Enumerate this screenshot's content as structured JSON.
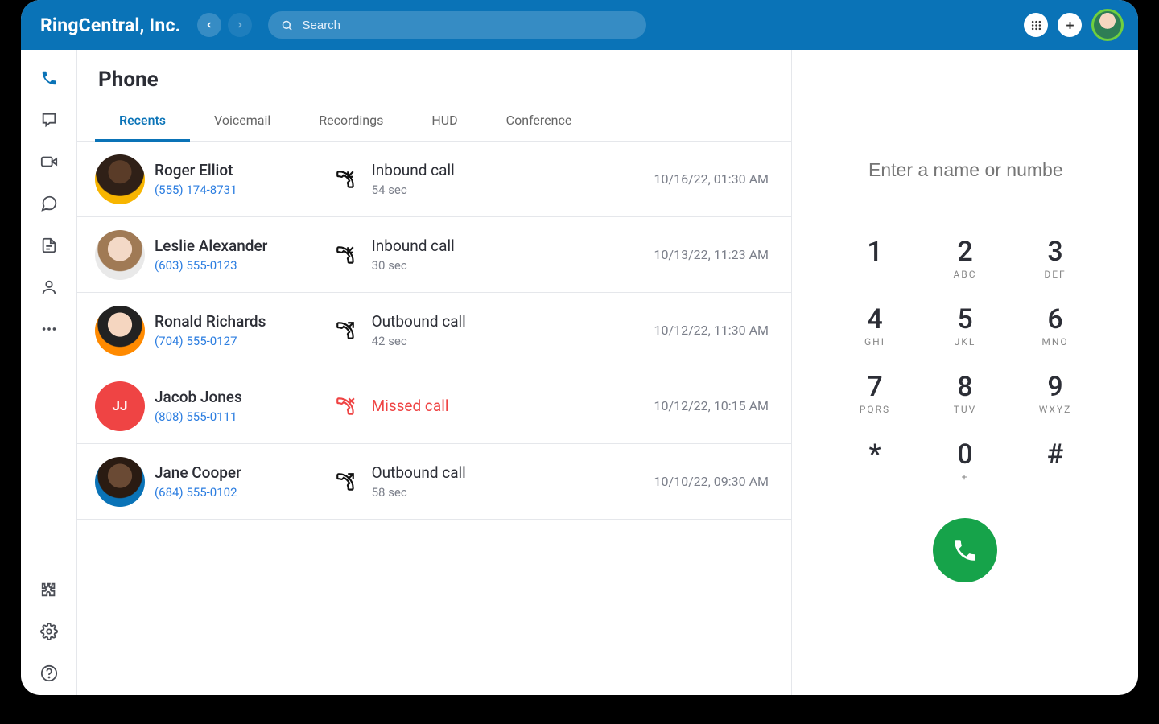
{
  "header": {
    "brand": "RingCentral, Inc.",
    "search_placeholder": "Search"
  },
  "page": {
    "title": "Phone"
  },
  "tabs": [
    "Recents",
    "Voicemail",
    "Recordings",
    "HUD",
    "Conference"
  ],
  "active_tab": 0,
  "calls": [
    {
      "name": "Roger Elliot",
      "number": "(555) 174-8731",
      "type": "Inbound call",
      "duration": "54 sec",
      "time": "10/16/22, 01:30 AM",
      "missed": false,
      "dir": "in",
      "initials": "",
      "avClass": "av-1"
    },
    {
      "name": "Leslie Alexander",
      "number": "(603) 555-0123",
      "type": "Inbound call",
      "duration": "30 sec",
      "time": "10/13/22, 11:23 AM",
      "missed": false,
      "dir": "in",
      "initials": "",
      "avClass": "av-2"
    },
    {
      "name": "Ronald Richards",
      "number": "(704) 555-0127",
      "type": "Outbound call",
      "duration": "42 sec",
      "time": "10/12/22, 11:30 AM",
      "missed": false,
      "dir": "out",
      "initials": "",
      "avClass": "av-3"
    },
    {
      "name": "Jacob Jones",
      "number": "(808) 555-0111",
      "type": "Missed call",
      "duration": "",
      "time": "10/12/22, 10:15 AM",
      "missed": true,
      "dir": "missed",
      "initials": "JJ",
      "avClass": "av-4"
    },
    {
      "name": "Jane Cooper",
      "number": "(684) 555-0102",
      "type": "Outbound call",
      "duration": "58 sec",
      "time": "10/10/22, 09:30 AM",
      "missed": false,
      "dir": "out",
      "initials": "",
      "avClass": "av-5"
    }
  ],
  "dialer": {
    "placeholder": "Enter a name or number",
    "keys": [
      {
        "d": "1",
        "l": ""
      },
      {
        "d": "2",
        "l": "ABC"
      },
      {
        "d": "3",
        "l": "DEF"
      },
      {
        "d": "4",
        "l": "GHI"
      },
      {
        "d": "5",
        "l": "JKL"
      },
      {
        "d": "6",
        "l": "MNO"
      },
      {
        "d": "7",
        "l": "PQRS"
      },
      {
        "d": "8",
        "l": "TUV"
      },
      {
        "d": "9",
        "l": "WXYZ"
      },
      {
        "d": "*",
        "l": ""
      },
      {
        "d": "0",
        "l": "+"
      },
      {
        "d": "#",
        "l": ""
      }
    ]
  }
}
